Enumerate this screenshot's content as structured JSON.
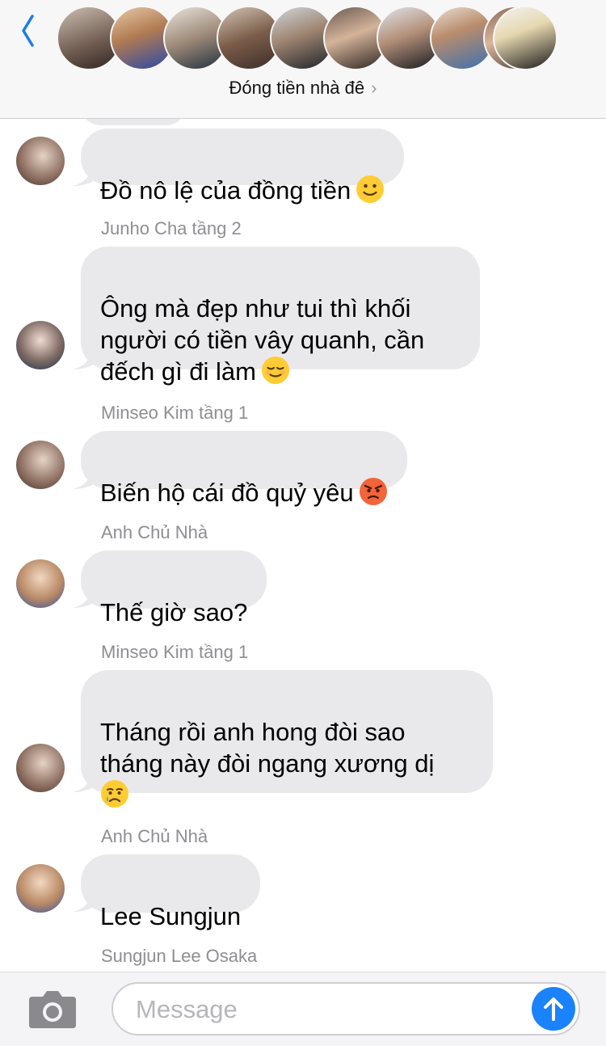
{
  "header": {
    "back_icon": "chevron-left-icon",
    "group_name": "Đóng tiền nhà đê",
    "chevron": "›",
    "participant_count": 10
  },
  "messages": [
    {
      "sender": "",
      "text": "Đồ nô lệ của đồng tiền",
      "emoji": "slight-smile"
    },
    {
      "sender": "Junho Cha tầng 2",
      "text": "Ông mà đẹp như tui thì khối\nngười có tiền vây quanh, cần\nđếch gì đi làm",
      "emoji": "relieved"
    },
    {
      "sender": "Minseo Kim tầng 1",
      "text": "Biến hộ cái đồ quỷ yêu",
      "emoji": "angry"
    },
    {
      "sender": "Anh Chủ Nhà",
      "text": "Thế giờ sao?",
      "emoji": ""
    },
    {
      "sender": "Minseo Kim tầng 1",
      "text": "Tháng rồi anh hong đòi sao\ntháng này đòi ngang xương dị\n",
      "emoji": "crying"
    },
    {
      "sender": "Anh Chủ Nhà",
      "text": "Lee Sungjun",
      "emoji": ""
    },
    {
      "sender": "Sungjun Lee Osaka",
      "text": "",
      "emoji": ""
    }
  ],
  "composer": {
    "placeholder": "Message",
    "camera_icon": "camera-icon",
    "send_icon": "arrow-up-icon"
  },
  "colors": {
    "bubble": "#e9e9eb",
    "accent": "#1a82fb",
    "sender_label": "#8e8e93"
  }
}
